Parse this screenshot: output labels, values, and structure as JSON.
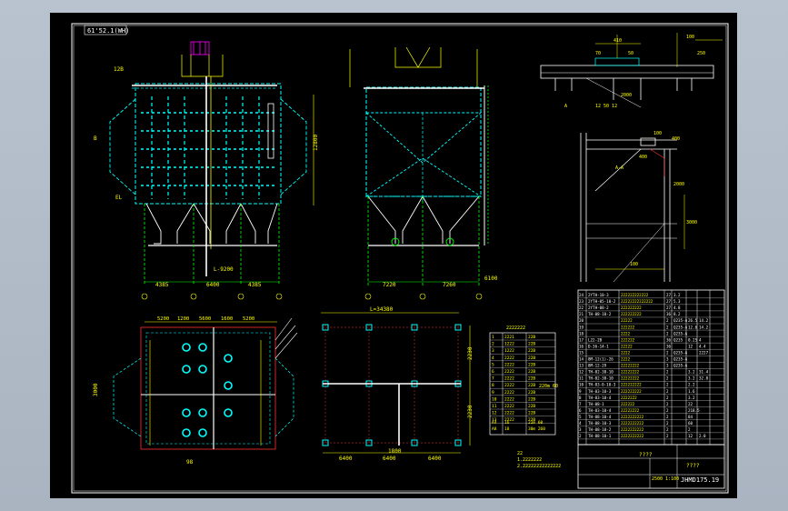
{
  "drawing": {
    "corner_tag": "61'52.1(WH)",
    "colors": {
      "background": "#000000",
      "frame": "#ffffff",
      "cyan": "#00ffff",
      "yellow": "#ffff00",
      "green": "#00ff00",
      "red": "#ff3030",
      "magenta": "#ff00ff"
    },
    "front_view": {
      "dims_bottom": [
        "4385",
        "6400",
        "4385"
      ],
      "dim_side": "12800",
      "label_top": "12B",
      "label_left": "B",
      "label_mid": "EL",
      "marker": "L-9200"
    },
    "side_view": {
      "dims_bottom": [
        "7220",
        "7260"
      ],
      "dim_right": "6100"
    },
    "plan_view": {
      "dims_top": [
        "5200",
        "1200",
        "5600",
        "1600",
        "5200"
      ],
      "dim_left": "3000",
      "dim_bottom": "98"
    },
    "foundation_plan": {
      "dim_top": "L=34380",
      "dims_bottom": [
        "6400",
        "6400",
        "6400"
      ],
      "dim_mid": "1800",
      "dims_right": [
        "2230",
        "2230"
      ]
    },
    "note_table": {
      "title": "2222222",
      "rows": [
        {
          "no": "1",
          "a": "2221",
          "b": "22B"
        },
        {
          "no": "2",
          "a": "1222",
          "b": "22B"
        },
        {
          "no": "3",
          "a": "1222",
          "b": "22B"
        },
        {
          "no": "4",
          "a": "2222",
          "b": "22B"
        },
        {
          "no": "5",
          "a": "2222",
          "b": "22B"
        },
        {
          "no": "6",
          "a": "2222",
          "b": "22B"
        },
        {
          "no": "7",
          "a": "2222",
          "b": "22B"
        },
        {
          "no": "8",
          "a": "2222",
          "b": "22B"
        },
        {
          "no": "9",
          "a": "2222",
          "b": "22B"
        },
        {
          "no": "10",
          "a": "2222",
          "b": "22B"
        },
        {
          "no": "11",
          "a": "2222",
          "b": "22B"
        },
        {
          "no": "12",
          "a": "2222",
          "b": "22B"
        },
        {
          "no": "13",
          "a": "2222",
          "b": "22B"
        }
      ],
      "side_note": "220m 60",
      "bottom_rows": [
        {
          "no": "A4",
          "a": "16",
          "b": "22m 60"
        },
        {
          "no": "A8",
          "a": "18",
          "b": "30m 260"
        }
      ]
    },
    "notes": {
      "title": "22",
      "line1": "1.2222222",
      "line2": "2.22222222222222"
    },
    "detail_top": {
      "dims": [
        "410",
        "70",
        "50",
        "100",
        "250",
        "2000",
        "12 50 12"
      ],
      "label": "A"
    },
    "detail_mid": {
      "dims": [
        "100",
        "400",
        "400",
        "2000",
        "3000",
        "100"
      ],
      "label": "A-A"
    },
    "parts_list": {
      "rows": [
        {
          "no": "24",
          "code": "2YTH-10-3",
          "name": "222222222222",
          "qty": "27",
          "m": "3.2",
          "w": "",
          "sum": ""
        },
        {
          "no": "23",
          "code": "2YTH-05-10-2",
          "name": "22222222222222",
          "qty": "27",
          "m": "5.3",
          "w": "",
          "sum": ""
        },
        {
          "no": "22",
          "code": "2YTH-08-2",
          "name": "222222222",
          "qty": "27",
          "m": "4.8",
          "w": "",
          "sum": ""
        },
        {
          "no": "21",
          "code": "TH-08-10-2",
          "name": "222222222",
          "qty": "36",
          "m": "8.2",
          "w": "",
          "sum": ""
        },
        {
          "no": "20",
          "code": "",
          "name": "22222",
          "qty": "2",
          "m": "Q235-A",
          "w": "26.5",
          "sum": "14.2"
        },
        {
          "no": "19",
          "code": "",
          "name": "222222",
          "qty": "2",
          "m": "Q235-A",
          "w": "12.6",
          "sum": "14.2"
        },
        {
          "no": "18",
          "code": "",
          "name": "2222",
          "qty": "2",
          "m": "Q235-A",
          "w": "",
          "sum": ""
        },
        {
          "no": "17",
          "code": "L22-2B",
          "name": "222222",
          "qty": "36",
          "m": "Q235",
          "w": "0.25",
          "sum": "4"
        },
        {
          "no": "16",
          "code": "D-36-14-1",
          "name": "22222",
          "qty": "36",
          "m": "",
          "w": "12",
          "sum": "4.4"
        },
        {
          "no": "15",
          "code": "",
          "name": "2222",
          "qty": "2",
          "m": "Q235-A",
          "w": "",
          "sum": "2227"
        },
        {
          "no": "14",
          "code": "8M-12(1)-26",
          "name": "2222",
          "qty": "3",
          "m": "Q235-A",
          "w": "",
          "sum": ""
        },
        {
          "no": "13",
          "code": "8M-12-29",
          "name": "22222222",
          "qty": "3",
          "m": "Q235-A",
          "w": "",
          "sum": ""
        },
        {
          "no": "12",
          "code": "TH-02-38-10",
          "name": "22222222",
          "qty": "2",
          "m": "",
          "w": "3.2",
          "sum": "31.4"
        },
        {
          "no": "11",
          "code": "TH-02-38-10",
          "name": "22222222",
          "qty": "2",
          "m": "",
          "w": "3.2",
          "sum": "32.8"
        },
        {
          "no": "10",
          "code": "TH-03-0-10-3",
          "name": "222222222",
          "qty": "2",
          "m": "",
          "w": "2.2",
          "sum": ""
        },
        {
          "no": "9",
          "code": "TH-03-10-3",
          "name": "222222222",
          "qty": "2",
          "m": "",
          "w": "1.6",
          "sum": ""
        },
        {
          "no": "8",
          "code": "TH-03-10-4",
          "name": "2222222",
          "qty": "2",
          "m": "",
          "w": "3.2",
          "sum": ""
        },
        {
          "no": "7",
          "code": "TH-08-1",
          "name": "222222",
          "qty": "2",
          "m": "",
          "w": "22",
          "sum": ""
        },
        {
          "no": "6",
          "code": "TH-03-10-4",
          "name": "22222222",
          "qty": "2",
          "m": "",
          "w": "218.5",
          "sum": ""
        },
        {
          "no": "5",
          "code": "TH-08-10-4",
          "name": "2222222222",
          "qty": "2",
          "m": "",
          "w": "84",
          "sum": ""
        },
        {
          "no": "4",
          "code": "TH-08-10-3",
          "name": "2222222222",
          "qty": "2",
          "m": "",
          "w": "60",
          "sum": ""
        },
        {
          "no": "3",
          "code": "TH-08-10-2",
          "name": "2222222222",
          "qty": "2",
          "m": "",
          "w": "2",
          "sum": ""
        },
        {
          "no": "2",
          "code": "TH-08-10-1",
          "name": "2222222222",
          "qty": "2",
          "m": "",
          "w": "12",
          "sum": "2.0"
        }
      ]
    },
    "title_block": {
      "title": "????",
      "company": "????",
      "scale": "2500 1:100",
      "drawing_no": "JHMD175.19"
    }
  }
}
